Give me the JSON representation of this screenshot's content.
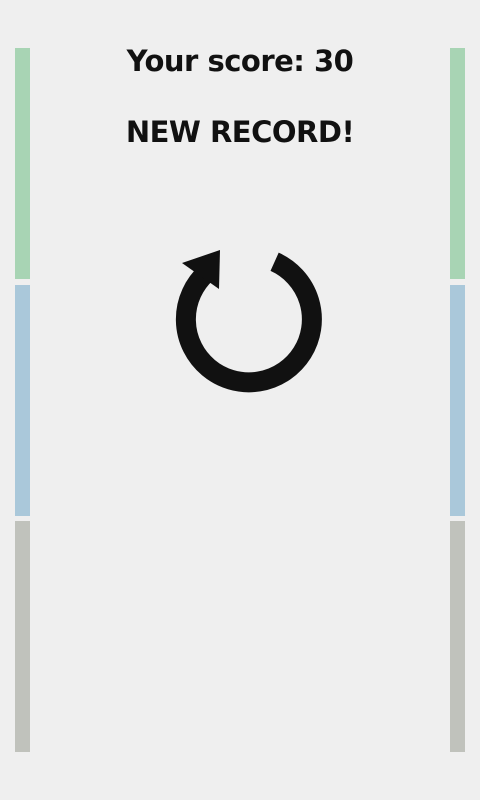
{
  "game": {
    "score_text": "Your score: 30",
    "record_text": "NEW RECORD!"
  },
  "colors": {
    "background": "#efefef",
    "bar_green": "#a8d4b4",
    "bar_blue": "#aac8da",
    "bar_gray": "#c0c2bc",
    "text": "#111111"
  },
  "icons": {
    "restart": "restart-icon"
  }
}
